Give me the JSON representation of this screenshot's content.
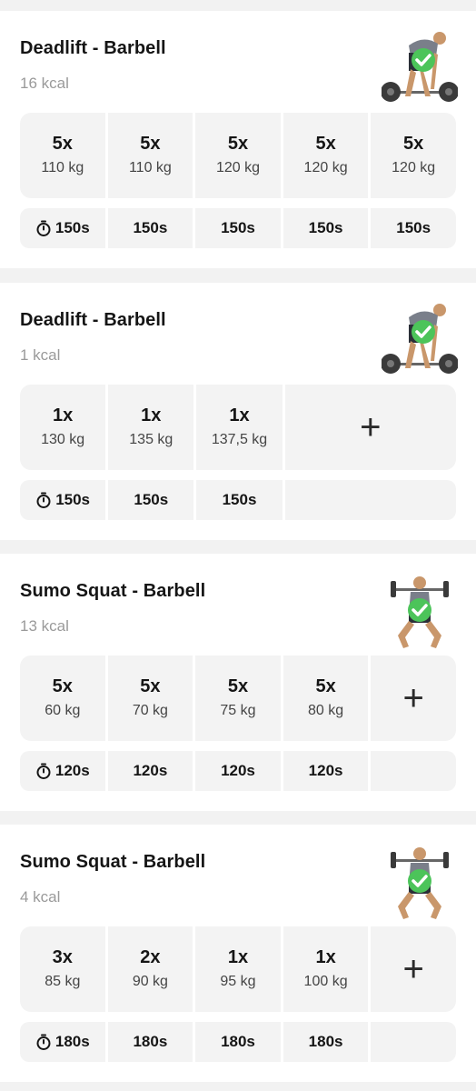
{
  "exercises": [
    {
      "title": "Deadlift - Barbell",
      "kcal": "16 kcal",
      "image": "deadlift-barbell-illustration",
      "completed": true,
      "sets": [
        {
          "reps": "5x",
          "weight": "110 kg"
        },
        {
          "reps": "5x",
          "weight": "110 kg"
        },
        {
          "reps": "5x",
          "weight": "120 kg"
        },
        {
          "reps": "5x",
          "weight": "120 kg"
        },
        {
          "reps": "5x",
          "weight": "120 kg"
        }
      ],
      "rests": [
        "150s",
        "150s",
        "150s",
        "150s",
        "150s"
      ],
      "add_button": null
    },
    {
      "title": "Deadlift - Barbell",
      "kcal": "1 kcal",
      "image": "deadlift-barbell-illustration",
      "completed": true,
      "sets": [
        {
          "reps": "1x",
          "weight": "130 kg"
        },
        {
          "reps": "1x",
          "weight": "135 kg"
        },
        {
          "reps": "1x",
          "weight": "137,5 kg"
        }
      ],
      "rests": [
        "150s",
        "150s",
        "150s"
      ],
      "add_button": "+"
    },
    {
      "title": "Sumo Squat - Barbell",
      "kcal": "13 kcal",
      "image": "sumo-squat-barbell-illustration",
      "completed": true,
      "sets": [
        {
          "reps": "5x",
          "weight": "60 kg"
        },
        {
          "reps": "5x",
          "weight": "70 kg"
        },
        {
          "reps": "5x",
          "weight": "75 kg"
        },
        {
          "reps": "5x",
          "weight": "80 kg"
        }
      ],
      "rests": [
        "120s",
        "120s",
        "120s",
        "120s"
      ],
      "add_button": "+"
    },
    {
      "title": "Sumo Squat - Barbell",
      "kcal": "4 kcal",
      "image": "sumo-squat-barbell-illustration",
      "completed": true,
      "sets": [
        {
          "reps": "3x",
          "weight": "85 kg"
        },
        {
          "reps": "2x",
          "weight": "90 kg"
        },
        {
          "reps": "1x",
          "weight": "95 kg"
        },
        {
          "reps": "1x",
          "weight": "100 kg"
        }
      ],
      "rests": [
        "180s",
        "180s",
        "180s",
        "180s"
      ],
      "add_button": "+"
    }
  ],
  "colors": {
    "check_green": "#4cc45a",
    "cell_bg": "#f3f3f3",
    "muted_text": "#9a9a9a"
  },
  "icons": {
    "rest": "timer-icon",
    "completed": "check-circle-icon"
  }
}
